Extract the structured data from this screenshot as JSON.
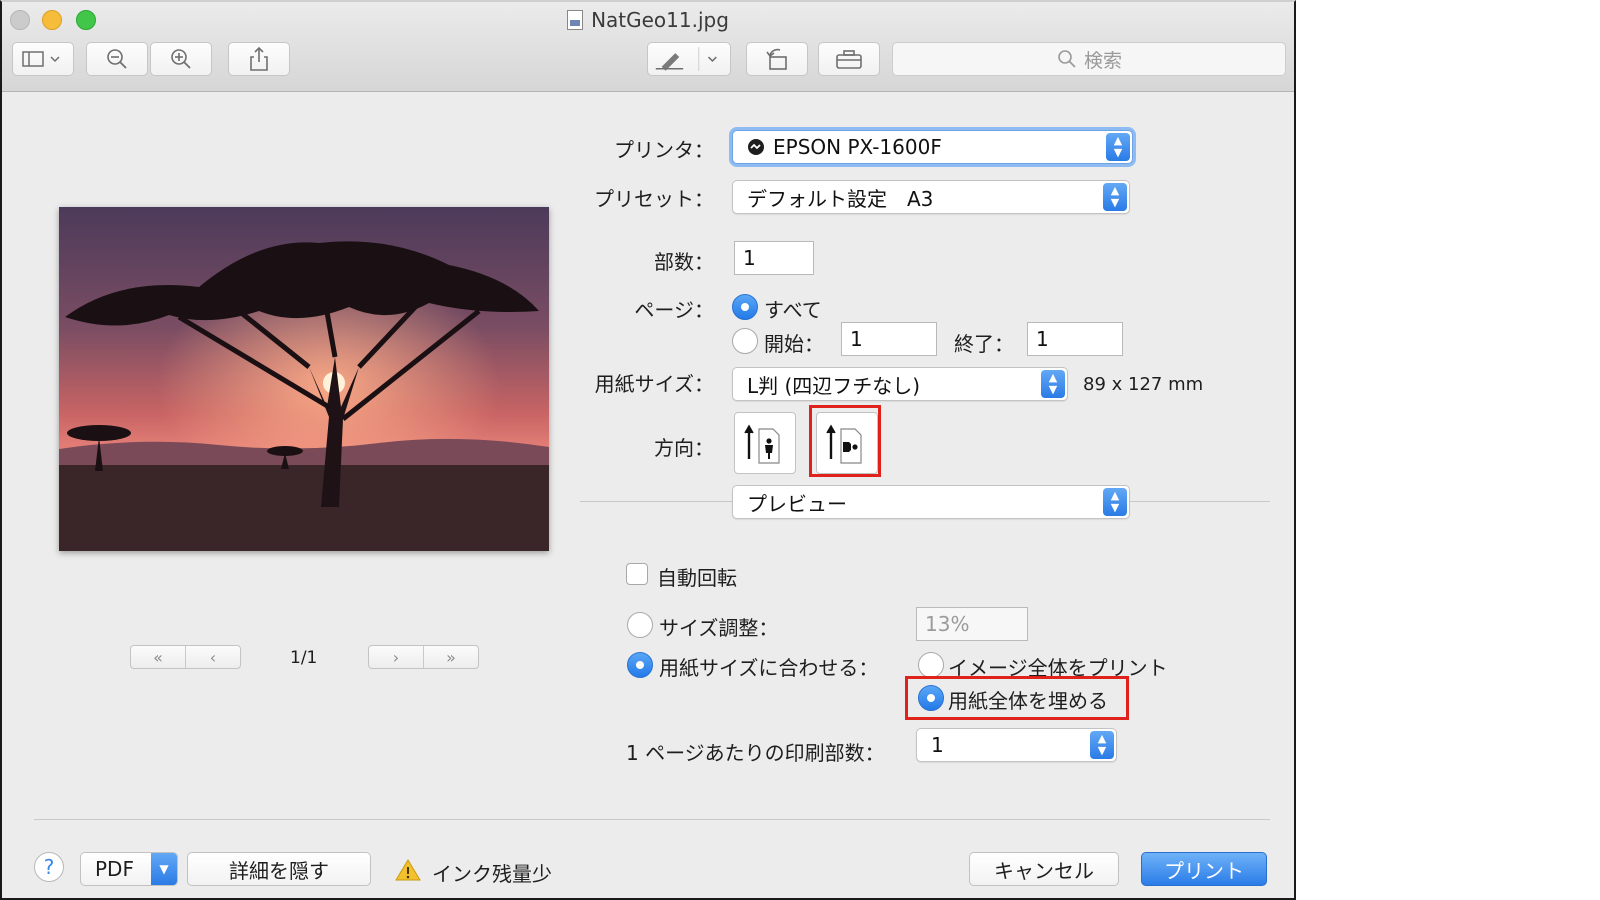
{
  "window": {
    "title": "NatGeo11.jpg"
  },
  "toolbar": {
    "search_placeholder": "検索"
  },
  "printer": {
    "label": "プリンタ：",
    "value": "EPSON PX-1600F"
  },
  "preset": {
    "label": "プリセット：",
    "value": "デフォルト設定　A3"
  },
  "copies": {
    "label": "部数：",
    "value": "1"
  },
  "pages": {
    "label": "ページ：",
    "all_label": "すべて",
    "range_label": "開始：",
    "from": "1",
    "to_label": "終了：",
    "to": "1",
    "selected": "all"
  },
  "paper_size": {
    "label": "用紙サイズ：",
    "value": "L判 (四辺フチなし)",
    "dimensions": "89 x 127 mm"
  },
  "orientation": {
    "label": "方向：",
    "selected": "landscape"
  },
  "section": {
    "value": "プレビュー"
  },
  "auto_rotate": {
    "label": "自動回転",
    "checked": false
  },
  "scale": {
    "label": "サイズ調整：",
    "value": "13%"
  },
  "fit": {
    "label": "用紙サイズに合わせる：",
    "print_entire": "イメージ全体をプリント",
    "fill_paper": "用紙全体を埋める",
    "selected": "fill_paper"
  },
  "pages_per_sheet": {
    "label": "1 ページあたりの印刷部数：",
    "value": "1"
  },
  "preview": {
    "page_indicator": "1/1"
  },
  "footer": {
    "help": "?",
    "pdf": "PDF",
    "hide_details": "詳細を隠す",
    "warning": "インク残量少",
    "cancel": "キャンセル",
    "print": "プリント"
  },
  "colors": {
    "accent": "#2a7ce8",
    "highlight": "#e0221c"
  },
  "icons": [
    "sidebar-icon",
    "zoom-out-icon",
    "zoom-in-icon",
    "share-icon",
    "markup-icon",
    "rotate-icon",
    "toolbox-icon",
    "search-icon",
    "warning-icon"
  ]
}
